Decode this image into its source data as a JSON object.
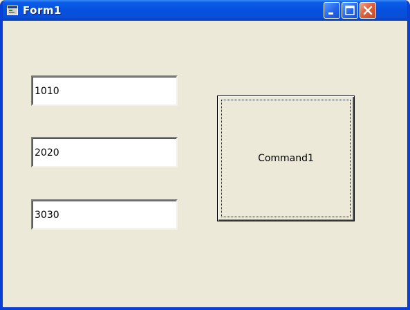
{
  "window": {
    "title": "Form1",
    "icon": "vb-form-icon"
  },
  "titlebar_buttons": {
    "minimize": "minimize-icon",
    "maximize": "maximize-icon",
    "close": "close-icon"
  },
  "form": {
    "text1": {
      "value": "1010"
    },
    "text2": {
      "value": "2020"
    },
    "text3": {
      "value": "3030"
    },
    "command1": {
      "label": "Command1"
    }
  },
  "colors": {
    "titlebar": "#0a5ce8",
    "form_background": "#ece9d8",
    "close_button": "#e0603a"
  }
}
